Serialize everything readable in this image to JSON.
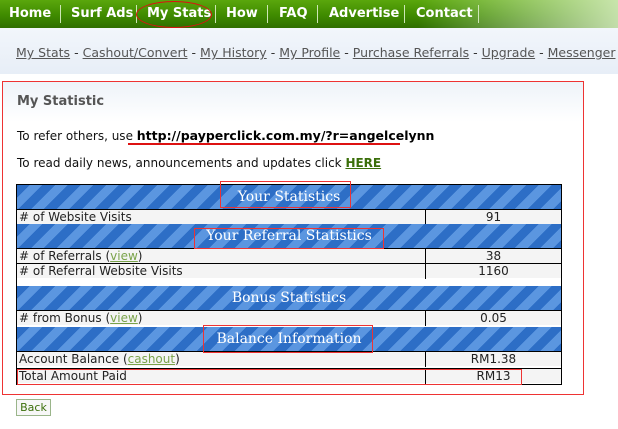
{
  "topnav": {
    "items": [
      "Home",
      "Surf Ads",
      "My Stats",
      "How",
      "FAQ",
      "Advertise",
      "Contact"
    ]
  },
  "subnav": {
    "links": [
      "My Stats",
      "Cashout/Convert",
      "My History",
      "My Profile",
      "Purchase Referrals",
      "Upgrade",
      "Messenger"
    ]
  },
  "main": {
    "title": "My Statistic",
    "refer_text": "To refer others, use ",
    "refer_url": "http://payperclick.com.my/?r=angelcelynn",
    "news_text": "To read daily news, announcements and updates click ",
    "news_link": "HERE"
  },
  "stats": {
    "your_stats_header": "Your Statistics",
    "website_visits_label": "# of Website Visits",
    "website_visits_value": "91",
    "referral_header": "Your Referral Statistics",
    "referrals_label": "# of Referrals (",
    "referrals_link": "view",
    "referrals_value": "38",
    "referral_visits_label": "# of Referral Website Visits",
    "referral_visits_value": "1160",
    "bonus_header": "Bonus Statistics",
    "bonus_label": "# from Bonus (",
    "bonus_link": "view",
    "bonus_value": "0.05",
    "balance_header": "Balance Information",
    "account_balance_label": "Account Balance (",
    "cashout_link": "cashout",
    "account_balance_value": "RM1.38",
    "total_paid_label": "Total Amount Paid",
    "total_paid_value": "RM13",
    "close_paren": ")"
  },
  "back_label": "Back",
  "colors": {
    "nav_green": "#3f8a00",
    "header_blue": "#2d6ec6",
    "annotation_red": "#e33"
  }
}
